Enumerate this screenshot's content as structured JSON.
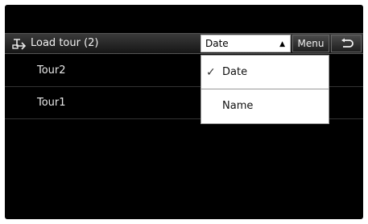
{
  "header": {
    "icon": "route-icon",
    "title": "Load tour (2)",
    "sort_value": "Date",
    "sort_arrow": "▲",
    "menu_label": "Menu",
    "back_icon": "back-arrow-icon"
  },
  "tours": [
    {
      "label": "Tour2"
    },
    {
      "label": "Tour1"
    }
  ],
  "sort_dropdown": {
    "options": [
      {
        "label": "Date",
        "selected": true,
        "check": "✓"
      },
      {
        "label": "Name",
        "selected": false,
        "check": ""
      }
    ]
  }
}
